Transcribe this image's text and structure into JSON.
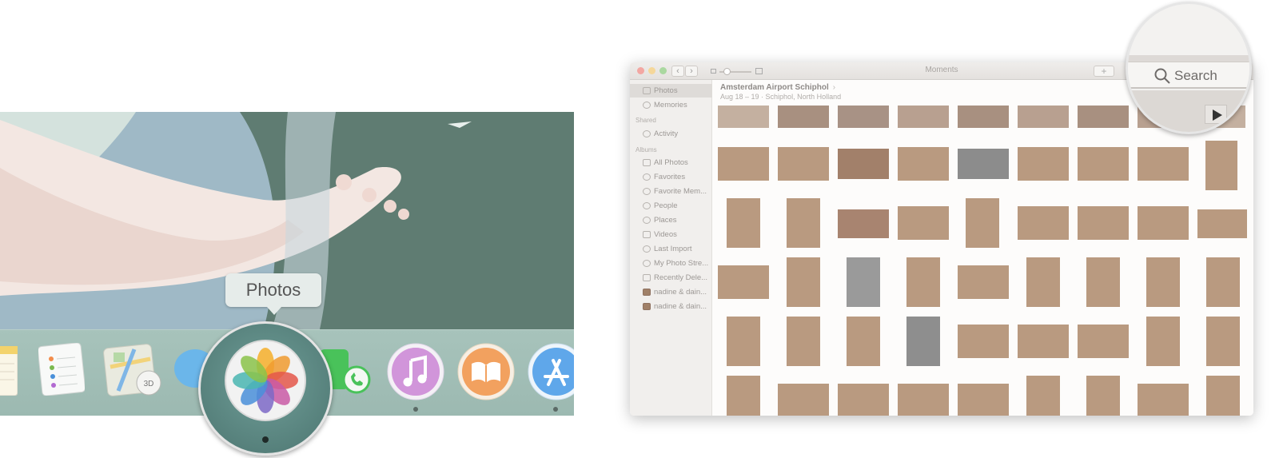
{
  "dock": {
    "tooltip": "Photos",
    "apps": [
      {
        "name": "Notes",
        "icon": "notes-icon"
      },
      {
        "name": "Reminders",
        "icon": "reminders-icon"
      },
      {
        "name": "Maps",
        "icon": "maps-icon"
      },
      {
        "name": "Messages",
        "icon": "messages-icon"
      },
      {
        "name": "Photos",
        "icon": "photos-icon"
      },
      {
        "name": "FaceTime",
        "icon": "facetime-icon"
      },
      {
        "name": "iTunes",
        "icon": "itunes-icon"
      },
      {
        "name": "iBooks",
        "icon": "ibooks-icon"
      },
      {
        "name": "App Store",
        "icon": "app-store-icon"
      }
    ],
    "maps_badge": "3D"
  },
  "window": {
    "title": "Moments",
    "plus": "+",
    "nav_back": "‹",
    "nav_forward": "›",
    "search_placeholder": "Search"
  },
  "sidebar": {
    "photos": "Photos",
    "memories": "Memories",
    "shared_header": "Shared",
    "activity": "Activity",
    "albums_header": "Albums",
    "albums": [
      "All Photos",
      "Favorites",
      "Favorite Mem...",
      "People",
      "Places",
      "Videos",
      "Last Import",
      "My Photo Stre...",
      "Recently Dele...",
      "nadine & dain...",
      "nadine & dain..."
    ]
  },
  "moment": {
    "title": "Amsterdam Airport Schiphol",
    "chevron": "›",
    "subtitle": "Aug 18 – 19 · Schiphol, North Holland"
  },
  "colors": {
    "dock_bg": "#9cb9b1",
    "wallpaper": "#5f7c72",
    "sidebar_bg": "#f1efed",
    "selection": "#dedbd8",
    "photo_tone": "#b99a80"
  }
}
